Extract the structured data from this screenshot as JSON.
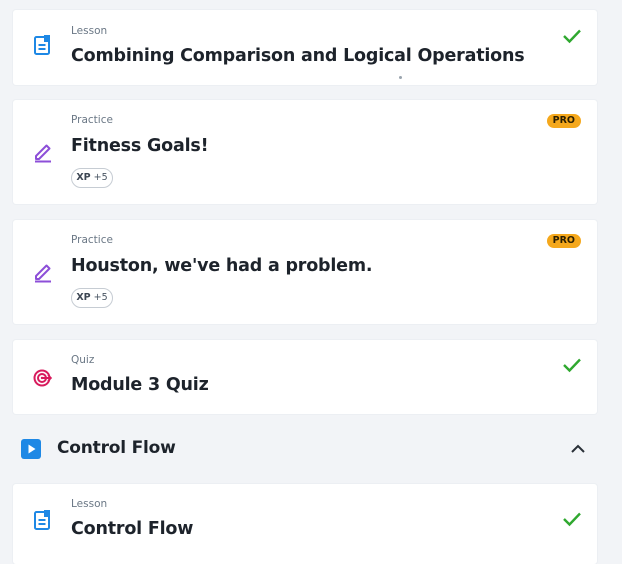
{
  "colors": {
    "background": "#f2f4f7",
    "card": "#ffffff",
    "check": "#2fa82f",
    "lesson_icon": "#1e88e5",
    "practice_icon": "#8d4fd8",
    "quiz_icon": "#d81b5d",
    "pro_badge": "#f5a81c"
  },
  "items": [
    {
      "type": "Lesson",
      "title": "Combining Comparison and Logical Operations",
      "icon": "lesson-icon",
      "completed": true
    },
    {
      "type": "Practice",
      "title": "Fitness Goals!",
      "icon": "pencil-icon",
      "badge": "PRO",
      "xp_label": "XP",
      "xp_value": "+5"
    },
    {
      "type": "Practice",
      "title": "Houston, we've had a problem.",
      "icon": "pencil-icon",
      "badge": "PRO",
      "xp_label": "XP",
      "xp_value": "+5"
    },
    {
      "type": "Quiz",
      "title": "Module 3 Quiz",
      "icon": "target-icon",
      "completed": true
    }
  ],
  "section": {
    "title": "Control Flow",
    "icon": "play-icon",
    "expanded": true
  },
  "section_items": [
    {
      "type": "Lesson",
      "title": "Control Flow",
      "icon": "lesson-icon",
      "completed": true
    }
  ]
}
